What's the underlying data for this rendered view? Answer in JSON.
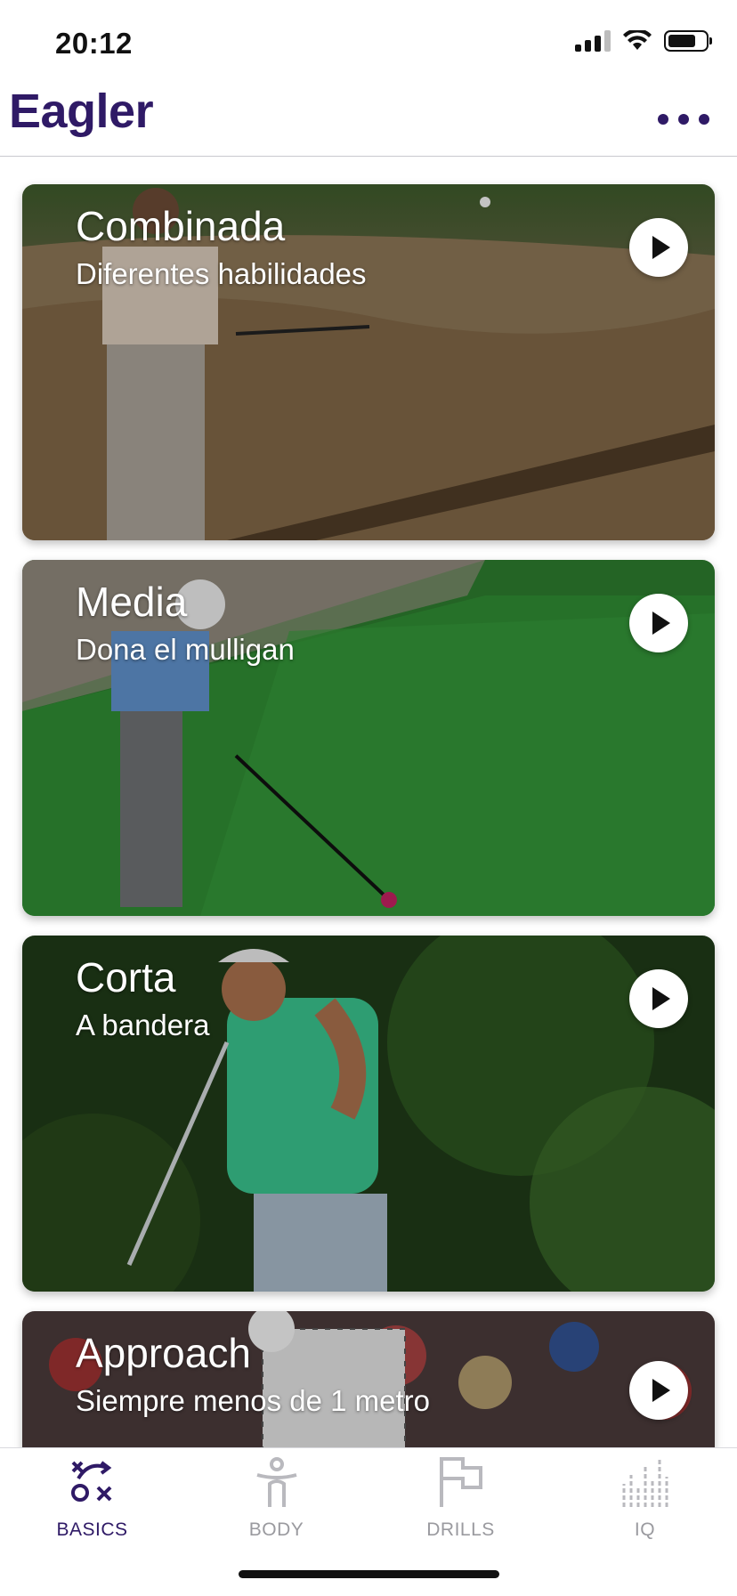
{
  "status_bar": {
    "time": "20:12"
  },
  "header": {
    "logo": "Eagler",
    "menu_icon": "more-icon"
  },
  "cards": [
    {
      "title": "Combinada",
      "subtitle": "Diferentes habilidades",
      "action_icon": "play-icon"
    },
    {
      "title": "Media",
      "subtitle": "Dona el mulligan",
      "action_icon": "play-icon"
    },
    {
      "title": "Corta",
      "subtitle": "A bandera",
      "action_icon": "play-icon"
    },
    {
      "title": "Approach",
      "subtitle": "Siempre menos de 1 metro",
      "action_icon": "play-icon"
    }
  ],
  "tabbar": {
    "tabs": [
      {
        "label": "BASICS",
        "icon": "tactics-icon",
        "active": true
      },
      {
        "label": "BODY",
        "icon": "body-icon",
        "active": false
      },
      {
        "label": "DRILLS",
        "icon": "flag-icon",
        "active": false
      },
      {
        "label": "IQ",
        "icon": "stats-icon",
        "active": false
      }
    ]
  },
  "colors": {
    "brand": "#2F1A66",
    "inactive": "#9A9A9F"
  }
}
